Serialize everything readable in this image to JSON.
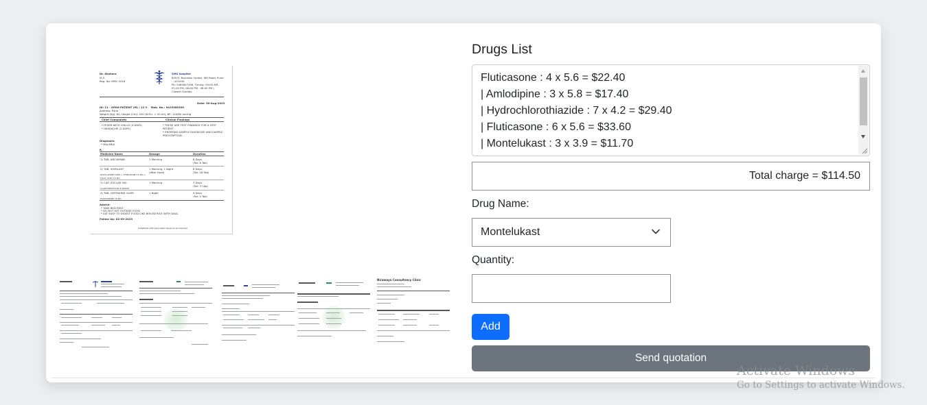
{
  "prescription": {
    "doctor_name": "Dr. Akshara",
    "doctor_degree": "M.S.",
    "doctor_reg": "Reg. No: MMC 2018",
    "hospital_name": "SMS hospital",
    "hospital_address": "B/503, Business Center, MG Road, Pune\n - 411000.",
    "hospital_phone": "Ph: 5465847456, Timing: 09:00 AM -",
    "hospital_timing": "01:00 PM, 06:00 PM - 08:00 PM |",
    "hospital_closed": "Closed: Sunday",
    "date": "Date: 30-Aug-2023",
    "patient_line": "ID: 11 - OPD6 PATIENT (M) / 12 Y    Mob. No.: 9423380390",
    "patient_address": "Address: Pune",
    "patient_vitals": "Weight (Kg): 80, Height (Cm): 200 (B.M.I. = 20.00), BP: 120/80 mmHg",
    "complaints_head": "Chief Complaints",
    "findings_head": "Clinical Findings",
    "complaint_1": "* FEVER WITH CHILLS (4 DAYS)",
    "complaint_2": "* HEADACHE (2 DAYS)",
    "finding_1": "* THESE ARE TEST FINDINGS FOR A TEST",
    "finding_1b": "PATIENT",
    "finding_2": "* ENTERING SAMPLE DIAGNOSIS AND SAMPLE",
    "finding_2b": "PRESCRIPTION",
    "diagnosis_head": "Diagnosis:",
    "diagnosis": "* MALARIA",
    "rx_symbol": "R",
    "col_medicine": "Medicine Name",
    "col_dosage": "Dosage",
    "col_duration": "Duration",
    "med_1": "1) TAB. ABCIXIMAB",
    "med_1_dose": "1 Morning",
    "med_1_dur": "8 Days\n(Tot: 8 Tab)",
    "med_2": "2) TAB. VOMILAST",
    "med_2_dose": "1 Morning, 1 Night\n(After Food)",
    "med_2_dur": "8 Days\n(Tot: 16 Tab)",
    "med_2_note": "DOXYLAMINE 10MG + PYRIDOXINE 10 MG +\nFOLIC ACID 2.5 MG",
    "med_3": "3) CAP. ZOCLAR 500",
    "med_3_dose": "1 Morning",
    "med_3_dur": "3 Days\n(Tot: 3 Cap)",
    "med_3_note": "CLARITHROMYCIN IP 500MG",
    "med_4": "4) TAB. GESTAKIND 10/SR",
    "med_4_dose": "1 Night",
    "med_4_dur": "4 Days\n(Tot: 4 Tab)",
    "med_4_note": "ISOXSUPRINE 10 MG",
    "advice_head": "Advice:",
    "advice_1": "* TAKE BED REST",
    "advice_2": "* DO NOT EAT OUTSIDE FOOD",
    "advice_3": "* EAT EASY TO DIGEST FOOD LIKE BOILED RICE WITH DAAL",
    "follow_up": "Follow Up: 04-09-2023",
    "footer_note": "Substitute with equivalent Generics as required.",
    "thumb_clinic_name": "Niramaya Consultancy Clinic"
  },
  "drugs_panel": {
    "title": "Drugs List",
    "lines": [
      "Fluticasone : 4 x 5.6 = $22.40",
      "| Amlodipine : 3 x 5.8 = $17.40",
      "| Hydrochlorothiazide : 7 x 4.2 = $29.40",
      "| Fluticasone : 6 x 5.6 = $33.60",
      "| Montelukast : 3 x 3.9 = $11.70"
    ],
    "total": "Total charge = $114.50",
    "drug_name_label": "Drug Name:",
    "drug_name_selected": "Montelukast",
    "quantity_label": "Quantity:",
    "quantity_value": "",
    "add_label": "Add",
    "send_label": "Send quotation"
  },
  "watermark": {
    "line1": "Activate Windows",
    "line2": "Go to Settings to activate Windows."
  },
  "colors": {
    "primary": "#0d6efd",
    "secondary": "#6c757d",
    "page_bg": "#eceef1"
  }
}
